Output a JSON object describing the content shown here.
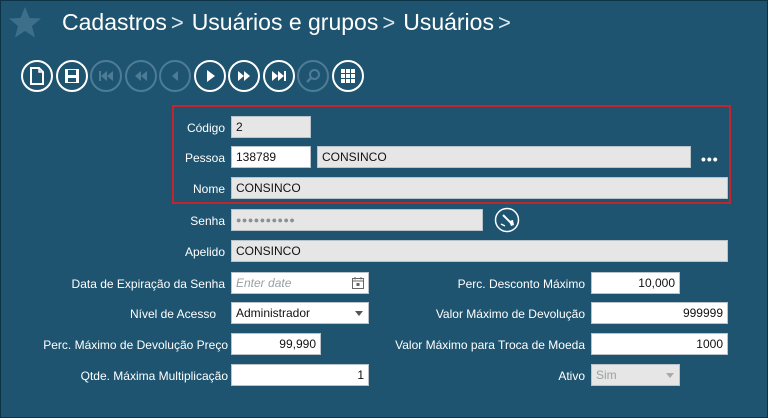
{
  "breadcrumb": {
    "items": [
      "Cadastros",
      "Usuários e grupos",
      "Usuários"
    ],
    "separator": ">"
  },
  "toolbar": {
    "buttons": [
      {
        "name": "new",
        "icon": "new-document-icon",
        "enabled": true
      },
      {
        "name": "save",
        "icon": "save-icon",
        "enabled": true
      },
      {
        "name": "first",
        "icon": "first-record-icon",
        "enabled": false
      },
      {
        "name": "rewind",
        "icon": "rewind-icon",
        "enabled": false
      },
      {
        "name": "previous",
        "icon": "previous-icon",
        "enabled": false
      },
      {
        "name": "next",
        "icon": "next-icon",
        "enabled": true
      },
      {
        "name": "fast-forward",
        "icon": "fast-forward-icon",
        "enabled": true
      },
      {
        "name": "last",
        "icon": "last-record-icon",
        "enabled": true
      },
      {
        "name": "search",
        "icon": "search-icon",
        "enabled": false
      },
      {
        "name": "grid",
        "icon": "grid-icon",
        "enabled": true
      }
    ]
  },
  "form": {
    "codigo": {
      "label": "Código",
      "value": "2"
    },
    "pessoa": {
      "label": "Pessoa",
      "id": "138789",
      "name": "CONSINCO",
      "more": "•••"
    },
    "nome": {
      "label": "Nome",
      "value": "CONSINCO"
    },
    "senha": {
      "label": "Senha",
      "value": "●●●●●●●●●●"
    },
    "apelido": {
      "label": "Apelido",
      "value": "CONSINCO"
    },
    "data_expiracao": {
      "label": "Data de Expiração da Senha",
      "placeholder": "Enter date"
    },
    "nivel_acesso": {
      "label": "Nível de Acesso",
      "value": "Administrador"
    },
    "perc_max_devolucao_preco": {
      "label": "Perc. Máximo de Devolução Preço",
      "value": "99,990"
    },
    "qtde_max_multiplicacao": {
      "label": "Qtde. Máxima Multiplicação",
      "value": "1"
    },
    "perc_desconto_maximo": {
      "label": "Perc. Desconto Máximo",
      "value": "10,000"
    },
    "valor_max_devolucao": {
      "label": "Valor Máximo de Devolução",
      "value": "999999"
    },
    "valor_max_troca_moeda": {
      "label": "Valor Máximo para Troca de Moeda",
      "value": "1000"
    },
    "ativo": {
      "label": "Ativo",
      "value": "Sim"
    }
  },
  "colors": {
    "background": "#1f5470",
    "highlight": "#c0262b",
    "readonly": "#e6e6e6"
  }
}
